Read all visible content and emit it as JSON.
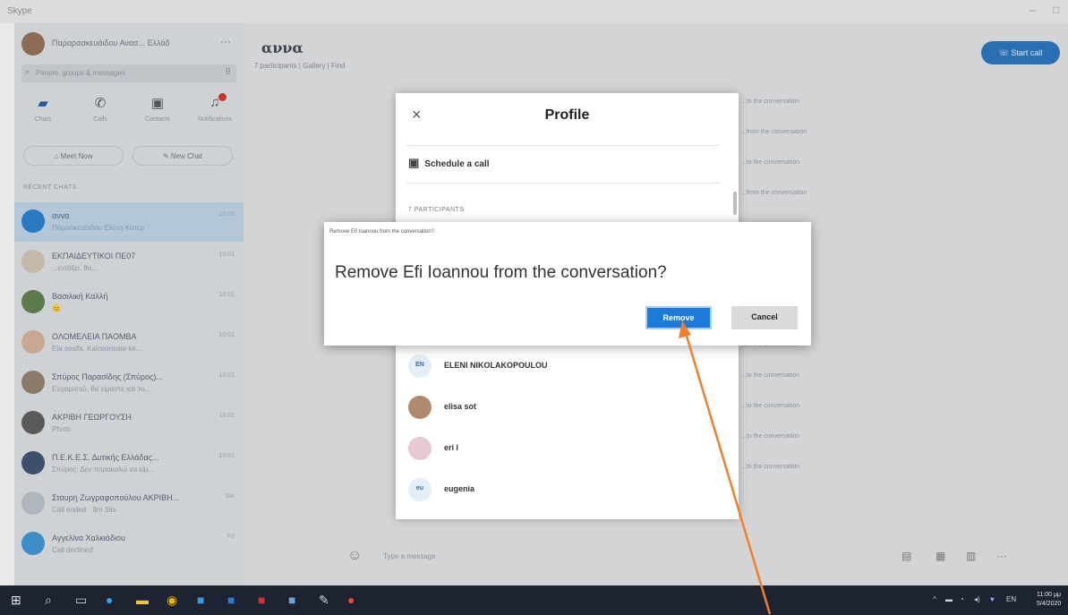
{
  "window": {
    "app_title": "Skype",
    "controls": [
      "–",
      "□"
    ]
  },
  "sidebar": {
    "profile_name": "Παραρασκευάιδου Ανασ... Ελλάδ",
    "more": "···",
    "search_placeholder": "People, groups & messages",
    "nav": [
      {
        "label": "Chats",
        "icon": "chat-icon"
      },
      {
        "label": "Calls",
        "icon": "phone-icon"
      },
      {
        "label": "Contacts",
        "icon": "contacts-icon"
      },
      {
        "label": "Notifications",
        "icon": "bell-icon"
      }
    ],
    "meet_now": "Meet Now",
    "new_chat": "New Chat",
    "section_label": "RECENT CHATS",
    "chats": [
      {
        "name": "αννα",
        "preview": "Παρασκευάιδου Ελένη Κατερ.",
        "time": "10:01",
        "avatar_color": "#2b78c2"
      },
      {
        "name": "ΕΚΠΑΙΔΕΥΤΙΚΟΙ ΠΕ07",
        "preview": "...εντάξει, θα...",
        "time": "10:01",
        "avatar_color": "#c6b8a8"
      },
      {
        "name": "Βασιλική Καλλή",
        "preview": "😊",
        "time": "10:01",
        "avatar_color": "#5c7a4a"
      },
      {
        "name": "ΟΛΟΜΕΛΕΙΑ ΠΑΟΜΒΑ",
        "preview": "Ela sosifa. Kalosorisate ke...",
        "time": "10:01",
        "avatar_color": "#c8a890"
      },
      {
        "name": "Σπύρος Παρασίδης (Σπύρος)...",
        "preview": "Ευχαριστώ, θα είμαστε και το...",
        "time": "10:01",
        "avatar_color": "#8a7a6a"
      },
      {
        "name": "ΑΚΡΙΒΗ ΓΕΩΡΓΟΥΣΗ",
        "preview": "Photo",
        "time": "10:01",
        "avatar_color": "#5a5a5a"
      },
      {
        "name": "Π.Ε.Κ.Ε.Σ. Δυτικής Ελλάδας...",
        "preview": "Σπύρος: Δεν παρακαλώ να είμ...",
        "time": "10:01",
        "avatar_color": "#3d4f6a"
      },
      {
        "name": "Σταυρη Ζωγραφοπούλου ΑΚΡΙΒΗ...",
        "preview": "Call ended · 9m 39s",
        "time": "Sat",
        "avatar_color": "#b0b6bd"
      },
      {
        "name": "Αγγελίνα Χαλκιάδιου",
        "preview": "Call declined",
        "time": "Fri",
        "avatar_color": "#3b8ec7"
      }
    ]
  },
  "conversation": {
    "title": "αννα",
    "subtitle": "7 participants | Gallery | Find",
    "start_call": "Start call",
    "system_messages": [
      "...to the conversation",
      "...from the conversation",
      "...to the conversation",
      "...from the conversation",
      "...",
      "...",
      "...",
      "...to the conversation",
      "...to the conversation",
      "...to the conversation",
      "...to the conversation",
      "...to the conversation",
      "...to the conversation"
    ],
    "composer_placeholder": "Type a message"
  },
  "profile_panel": {
    "title": "Profile",
    "close": "×",
    "schedule_call": "Schedule a call",
    "participants_label": "7 PARTICIPANTS",
    "members": [
      {
        "initials": "EN",
        "name": "ELENI NIKOLAKOPOULOU",
        "bg": "#e4eef9",
        "fg": "#2b6fb3"
      },
      {
        "initials": "",
        "name": "elisa sot",
        "bg": "#b08a6e",
        "fg": "#ffffff"
      },
      {
        "initials": "",
        "name": "eri l",
        "bg": "#e8c8d4",
        "fg": "#ffffff"
      },
      {
        "initials": "eu",
        "name": "eugenia",
        "bg": "#e4eef9",
        "fg": "#2b6fb3"
      }
    ]
  },
  "dialog": {
    "window_title": "Remove Efi Ioannou from the conversation?",
    "question": "Remove Efi Ioannou from the conversation?",
    "remove_label": "Remove",
    "cancel_label": "Cancel"
  },
  "taskbar": {
    "tray_lang": "ΕΝ",
    "time": "11:00 μμ",
    "date": "5/4/2020"
  },
  "annotation": {
    "arrow_color": "#f07f2a"
  }
}
